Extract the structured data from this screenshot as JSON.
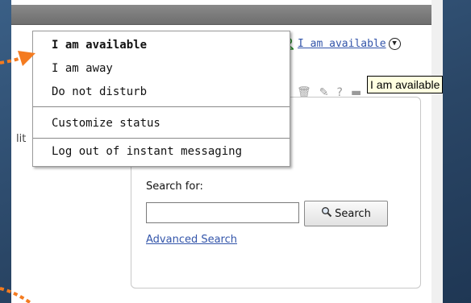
{
  "status": {
    "current_label": "I am available",
    "tooltip": "I am available"
  },
  "menu": {
    "items": [
      {
        "label": "I am available"
      },
      {
        "label": "I am away"
      },
      {
        "label": "Do not disturb"
      },
      {
        "label": "Customize status"
      },
      {
        "label": "Log out of instant messaging"
      }
    ]
  },
  "page": {
    "left_stub": "lit"
  },
  "search": {
    "label": "Search for:",
    "input_value": "",
    "button_label": "Search",
    "advanced_link": "Advanced Search"
  },
  "colors": {
    "link": "#3355aa",
    "arrow": "#f47b20",
    "background": "#2a4666"
  },
  "icons": [
    "person-icon",
    "circle-dropdown-icon",
    "trash-icon",
    "wrench-icon",
    "help-icon",
    "minimize-icon",
    "magnifier-icon"
  ]
}
